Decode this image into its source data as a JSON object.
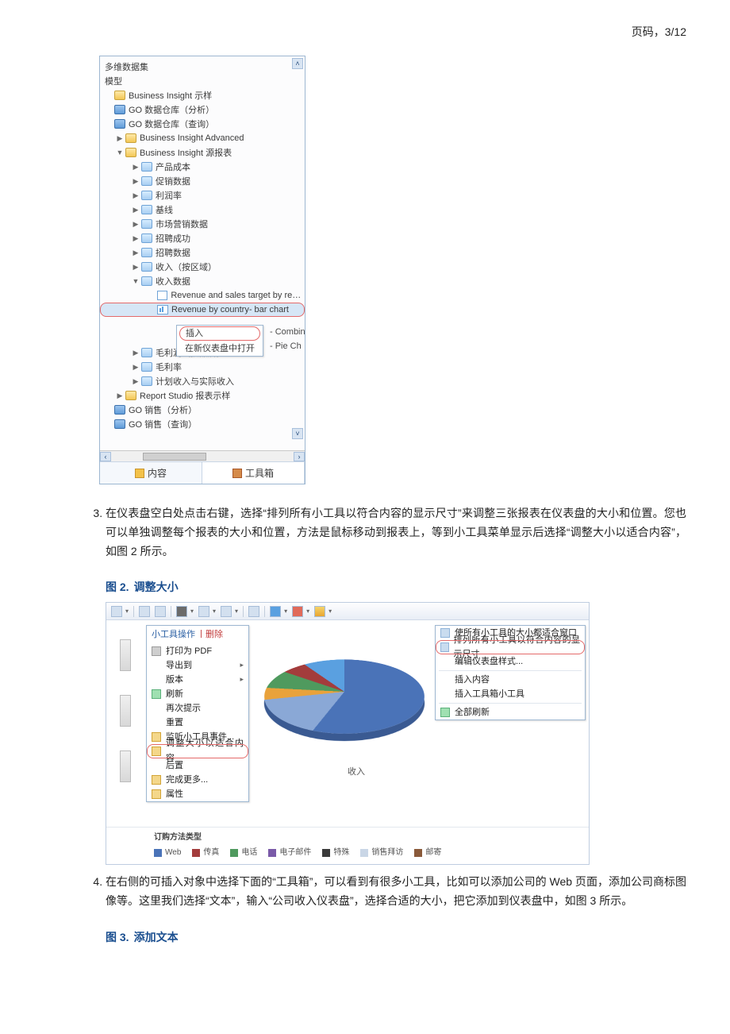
{
  "pageHeader": {
    "label": "页码，3/12"
  },
  "tree": {
    "headers": {
      "dataset": "多维数据集",
      "model": "模型"
    },
    "nodes": [
      {
        "id": "n1",
        "indent": 0,
        "tw": "",
        "icon": "folder",
        "label": "Business Insight 示样"
      },
      {
        "id": "n2",
        "indent": 0,
        "tw": "",
        "icon": "pkg",
        "label": "GO 数据仓库（分析）"
      },
      {
        "id": "n3",
        "indent": 0,
        "tw": "",
        "icon": "pkg",
        "label": "GO 数据仓库（查询）"
      },
      {
        "id": "n4",
        "indent": 1,
        "tw": "▶",
        "icon": "folder",
        "label": "Business Insight Advanced"
      },
      {
        "id": "n5",
        "indent": 1,
        "tw": "▼",
        "icon": "folder",
        "label": "Business Insight 源报表"
      },
      {
        "id": "n6",
        "indent": 2,
        "tw": "▶",
        "icon": "rep",
        "label": "产品成本"
      },
      {
        "id": "n7",
        "indent": 2,
        "tw": "▶",
        "icon": "rep",
        "label": "促销数据"
      },
      {
        "id": "n8",
        "indent": 2,
        "tw": "▶",
        "icon": "rep",
        "label": "利润率"
      },
      {
        "id": "n9",
        "indent": 2,
        "tw": "▶",
        "icon": "rep",
        "label": "基线"
      },
      {
        "id": "n10",
        "indent": 2,
        "tw": "▶",
        "icon": "rep",
        "label": "市场营销数据"
      },
      {
        "id": "n11",
        "indent": 2,
        "tw": "▶",
        "icon": "rep",
        "label": "招聘成功"
      },
      {
        "id": "n12",
        "indent": 2,
        "tw": "▶",
        "icon": "rep",
        "label": "招聘数据"
      },
      {
        "id": "n13",
        "indent": 2,
        "tw": "▶",
        "icon": "rep",
        "label": "收入（按区域）"
      },
      {
        "id": "n14",
        "indent": 2,
        "tw": "▼",
        "icon": "rep",
        "label": "收入数据"
      },
      {
        "id": "n15",
        "indent": 3,
        "tw": "",
        "icon": "grid",
        "label": "Revenue and sales target by region"
      },
      {
        "id": "n16",
        "indent": 3,
        "tw": "",
        "icon": "chart",
        "label": "Revenue by country- bar chart",
        "hl": true
      },
      {
        "id": "ctx",
        "context": true
      },
      {
        "id": "n19",
        "indent": 2,
        "tw": "▶",
        "icon": "rep",
        "label": "毛利润（按品牌）"
      },
      {
        "id": "n20",
        "indent": 2,
        "tw": "▶",
        "icon": "rep",
        "label": "毛利率"
      },
      {
        "id": "n21",
        "indent": 2,
        "tw": "▶",
        "icon": "rep",
        "label": "计划收入与实际收入"
      },
      {
        "id": "n22",
        "indent": 1,
        "tw": "▶",
        "icon": "folder",
        "label": "Report Studio 报表示样"
      },
      {
        "id": "n23",
        "indent": 0,
        "tw": "",
        "icon": "pkg",
        "label": "GO 销售（分析）"
      },
      {
        "id": "n24",
        "indent": 0,
        "tw": "",
        "icon": "pkg",
        "label": "GO 销售（查询）"
      }
    ],
    "contextMenu": {
      "insert": "插入",
      "openNew": "在新仪表盘中打开"
    },
    "sideList": {
      "combin": "- Combin",
      "pie": "- Pie Ch"
    },
    "tabs": {
      "content": "内容",
      "toolbox": "工具箱"
    }
  },
  "steps": {
    "step3": "在仪表盘空白处点击右键，选择“排列所有小工具以符合内容的显示尺寸”来调整三张报表在仪表盘的大小和位置。您也可以单独调整每个报表的大小和位置，方法是鼠标移动到报表上，等到小工具菜单显示后选择“调整大小以适合内容”，如图 2 所示。",
    "step4": "在右侧的可插入对象中选择下面的“工具箱”，可以看到有很多小工具，比如可以添加公司的 Web 页面，添加公司商标图像等。这里我们选择“文本”，输入“公司收入仪表盘”，选择合适的大小，把它添加到仪表盘中，如图 3 所示。"
  },
  "fig2": {
    "caption": {
      "label": "图 2.",
      "title": "调整大小"
    },
    "widgetMenu": {
      "header": "小工具操作",
      "headerDel": "丨删除",
      "items": [
        {
          "label": "打印为 PDF",
          "icon": "print"
        },
        {
          "label": "导出到",
          "arrow": true
        },
        {
          "label": "版本",
          "arrow": true
        },
        {
          "label": "刷新",
          "icon": "ref"
        },
        {
          "label": "再次提示"
        },
        {
          "label": "重置"
        },
        {
          "label": "监听小工具事件...",
          "icon": "cfg"
        },
        {
          "label": "调整大小以适合内容",
          "hl": true,
          "icon": "cfg"
        },
        {
          "label": "后置"
        },
        {
          "label": "完成更多...",
          "icon": "cfg"
        },
        {
          "label": "属性",
          "icon": "cfg"
        }
      ]
    },
    "pieLabel": "收入",
    "fitMenu": {
      "items": [
        {
          "label": "使所有小工具的大小都适合窗口",
          "icon": "cfg"
        },
        {
          "label": "排列所有小工具以符合内容的显示尺寸",
          "hl": true,
          "icon": "cfg"
        },
        {
          "label": "编辑仪表盘样式..."
        },
        {
          "divider": true
        },
        {
          "label": "插入内容"
        },
        {
          "label": "插入工具箱小工具"
        },
        {
          "divider": true
        },
        {
          "label": "全部刷新",
          "icon": "ref"
        }
      ]
    },
    "legend": {
      "title": "订购方法类型",
      "items": [
        {
          "label": "Web",
          "color": "#4a73b8"
        },
        {
          "label": "传真",
          "color": "#a33c3c"
        },
        {
          "label": "电话",
          "color": "#4f9a5e"
        },
        {
          "label": "电子邮件",
          "color": "#7a5aa8"
        },
        {
          "label": "特殊",
          "color": "#3a3a3a"
        },
        {
          "label": "销售拜访",
          "color": "#c9d6e6"
        },
        {
          "label": "邮寄",
          "color": "#8a5a3a"
        }
      ]
    }
  },
  "fig3": {
    "caption": {
      "label": "图 3.",
      "title": "添加文本"
    }
  },
  "chart_data": {
    "type": "pie",
    "title": "收入",
    "series": [
      {
        "name": "Web",
        "value": 57
      },
      {
        "name": "传真",
        "value": 6
      },
      {
        "name": "电话",
        "value": 7
      },
      {
        "name": "电子邮件",
        "value": 4
      },
      {
        "name": "特殊",
        "value": 15
      },
      {
        "name": "销售拜访",
        "value": 6
      },
      {
        "name": "邮寄",
        "value": 5
      }
    ],
    "legend_position": "bottom"
  }
}
